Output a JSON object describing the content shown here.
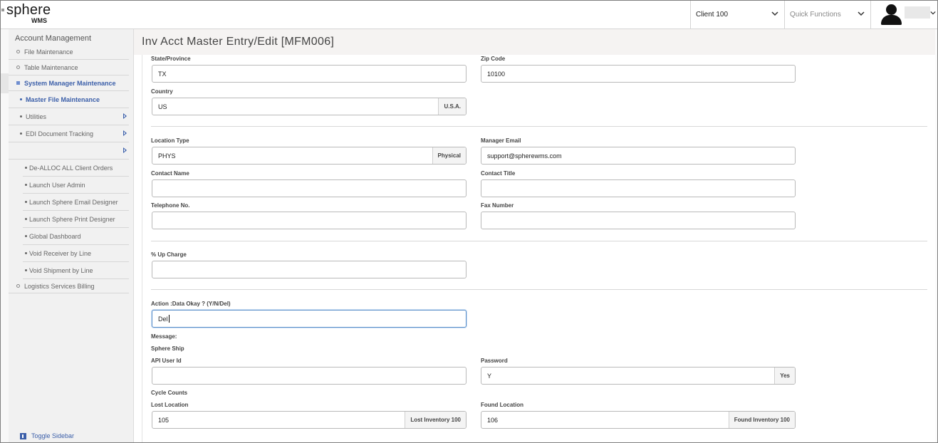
{
  "header": {
    "logo_top": "sphere",
    "logo_bottom": "WMS",
    "client_select": "Client 100",
    "quick_functions": "Quick Functions"
  },
  "sidebar": {
    "heading": "Account Management",
    "items": [
      {
        "label": "File Maintenance"
      },
      {
        "label": "Table Maintenance"
      },
      {
        "label": "System Manager Maintenance"
      },
      {
        "label": "Master File Maintenance"
      },
      {
        "label": "Utilities"
      },
      {
        "label": "EDI Document Tracking"
      }
    ],
    "sub_items": [
      {
        "label": "De-ALLOC ALL Client Orders"
      },
      {
        "label": "Launch User Admin"
      },
      {
        "label": "Launch Sphere Email Designer"
      },
      {
        "label": "Launch Sphere Print Designer"
      },
      {
        "label": "Global Dashboard"
      },
      {
        "label": "Void Receiver by Line"
      },
      {
        "label": "Void Shipment by Line"
      }
    ],
    "last_item": "Logistics Services Billing",
    "toggle": "Toggle Sidebar"
  },
  "page": {
    "title": "Inv Acct Master Entry/Edit [MFM006]"
  },
  "form": {
    "state_label": "State/Province",
    "state_value": "TX",
    "zip_label": "Zip Code",
    "zip_value": "10100",
    "country_label": "Country",
    "country_value": "US",
    "country_addon": "U.S.A.",
    "location_type_label": "Location Type",
    "location_type_value": "PHYS",
    "location_type_addon": "Physical",
    "manager_email_label": "Manager Email",
    "manager_email_value": "support@spherewms.com",
    "contact_name_label": "Contact Name",
    "contact_name_value": "",
    "contact_title_label": "Contact Title",
    "contact_title_value": "",
    "telephone_label": "Telephone No.",
    "telephone_value": "",
    "fax_label": "Fax Number",
    "fax_value": "",
    "upcharge_label": "% Up Charge",
    "upcharge_value": "",
    "action_label": "Action :Data Okay ? (Y/N/Del)",
    "action_value": "Del",
    "message_label": "Message:",
    "sphere_ship_label": "Sphere Ship",
    "api_user_label": "API User Id",
    "api_user_value": "",
    "password_label": "Password",
    "password_value": "Y",
    "password_addon": "Yes",
    "cycle_counts_label": "Cycle Counts",
    "lost_location_label": "Lost Location",
    "lost_location_value": "105",
    "lost_location_addon": "Lost Inventory 100",
    "found_location_label": "Found Location",
    "found_location_value": "106",
    "found_location_addon": "Found Inventory 100"
  }
}
